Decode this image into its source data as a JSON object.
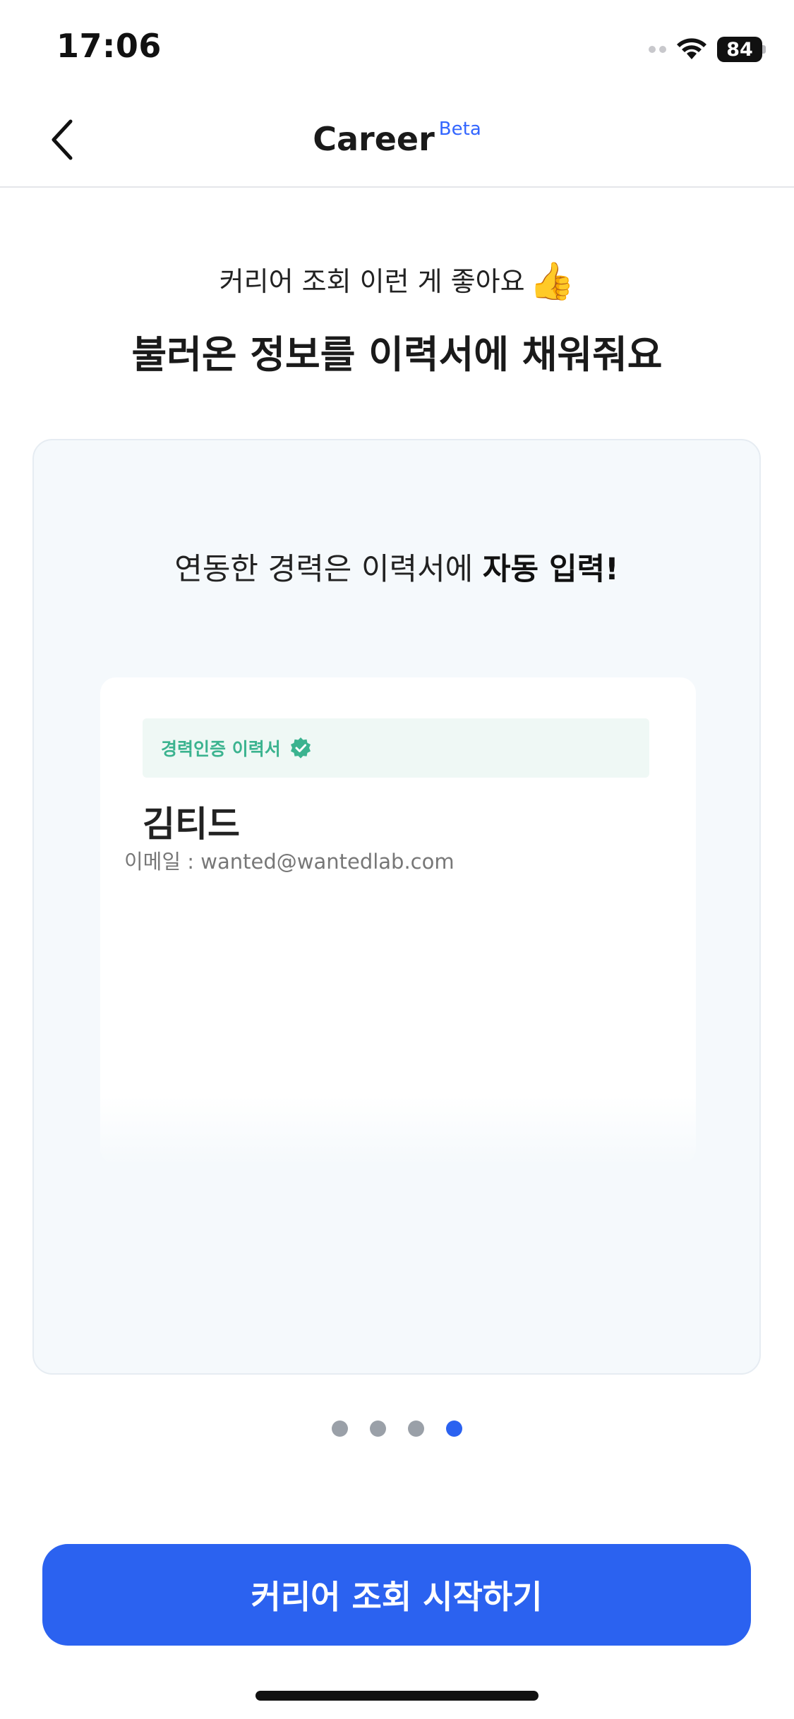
{
  "status_bar": {
    "time": "17:06",
    "battery": "84"
  },
  "nav": {
    "title": "Career",
    "badge": "Beta"
  },
  "headline": {
    "sub": "커리어 조회 이런 게 좋아요",
    "thumb_emoji": "👍",
    "main": "불러온 정보를 이력서에 채워줘요"
  },
  "slide": {
    "caption_plain": "연동한 경력은 이력서에 ",
    "caption_bold": "자동 입력!",
    "resume": {
      "verified_label": "경력인증 이력서",
      "name": "김티드",
      "email": "이메일 : wanted@wantedlab.com"
    }
  },
  "pager": {
    "count": 4,
    "active_index": 3
  },
  "cta": {
    "label": "커리어 조회 시작하기"
  },
  "colors": {
    "primary": "#2b62f0",
    "verified": "#3bb38f",
    "card_bg": "#f5f9fc"
  },
  "icons": {
    "back": "chevron-left-icon",
    "wifi": "wifi-icon",
    "verified": "verified-badge-icon"
  }
}
